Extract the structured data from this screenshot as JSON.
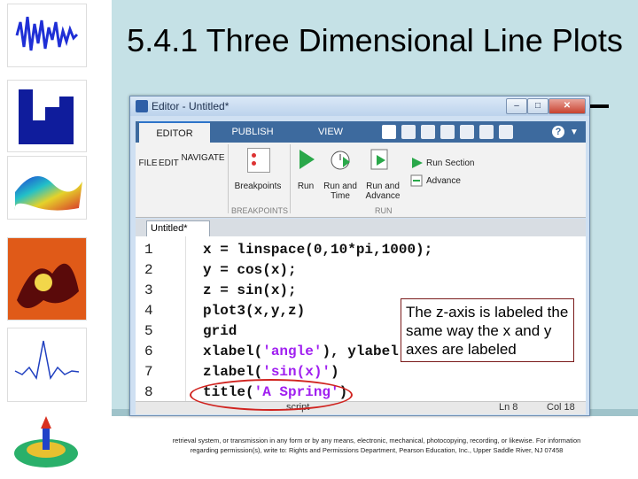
{
  "slide": {
    "title": "5.4.1 Three Dimensional Line Plots",
    "footer": "retrieval system, or transmission in any form or by any means, electronic, mechanical, photocopying, recording, or likewise. For information regarding permission(s), write to: Rights and Permissions Department, Pearson Education, Inc., Upper Saddle River, NJ 07458"
  },
  "editor": {
    "window_title_app": "Editor - Untitled*",
    "window_buttons": [
      "–",
      "□",
      "✕"
    ],
    "ribbon_tabs": [
      "EDITOR",
      "PUBLISH",
      "VIEW"
    ],
    "ribbon": {
      "file": "FILE",
      "edit": "EDIT",
      "navigate": "NAVIGATE",
      "breakpoints": "Breakpoints",
      "breakpoints_group": "BREAKPOINTS",
      "run": "Run",
      "run_and_time": "Run and Time",
      "run_and_advance": "Run and Advance",
      "run_section": "Run Section",
      "advance": "Advance",
      "run_group": "RUN"
    },
    "document_tab": "Untitled*",
    "code_lines": [
      {
        "num": "1",
        "text": "x = linspace(0,10*pi,1000);"
      },
      {
        "num": "2",
        "text": "y = cos(x);"
      },
      {
        "num": "3",
        "text": "z = sin(x);"
      },
      {
        "num": "4",
        "text": "plot3(x,y,z)"
      },
      {
        "num": "5",
        "text": "grid"
      },
      {
        "num": "6",
        "pre": "xlabel(",
        "str": "'angle'",
        "post": "), ylabel"
      },
      {
        "num": "7",
        "pre": "zlabel(",
        "str": "'sin(x)'",
        "post": ")"
      },
      {
        "num": "8",
        "pre": "title(",
        "str": "'A Spring'",
        "post": ")"
      }
    ],
    "status": {
      "mode": "script",
      "ln": "Ln 8",
      "col": "Col 18"
    }
  },
  "callout": "The z-axis is labeled the same way the x and y axes are labeled",
  "colors": {
    "slide_bg": "#c5e1e6",
    "string_purple": "#a020f0",
    "highlight_red": "#d0231f",
    "ribbon_tab_bar": "#3d6a9e"
  }
}
